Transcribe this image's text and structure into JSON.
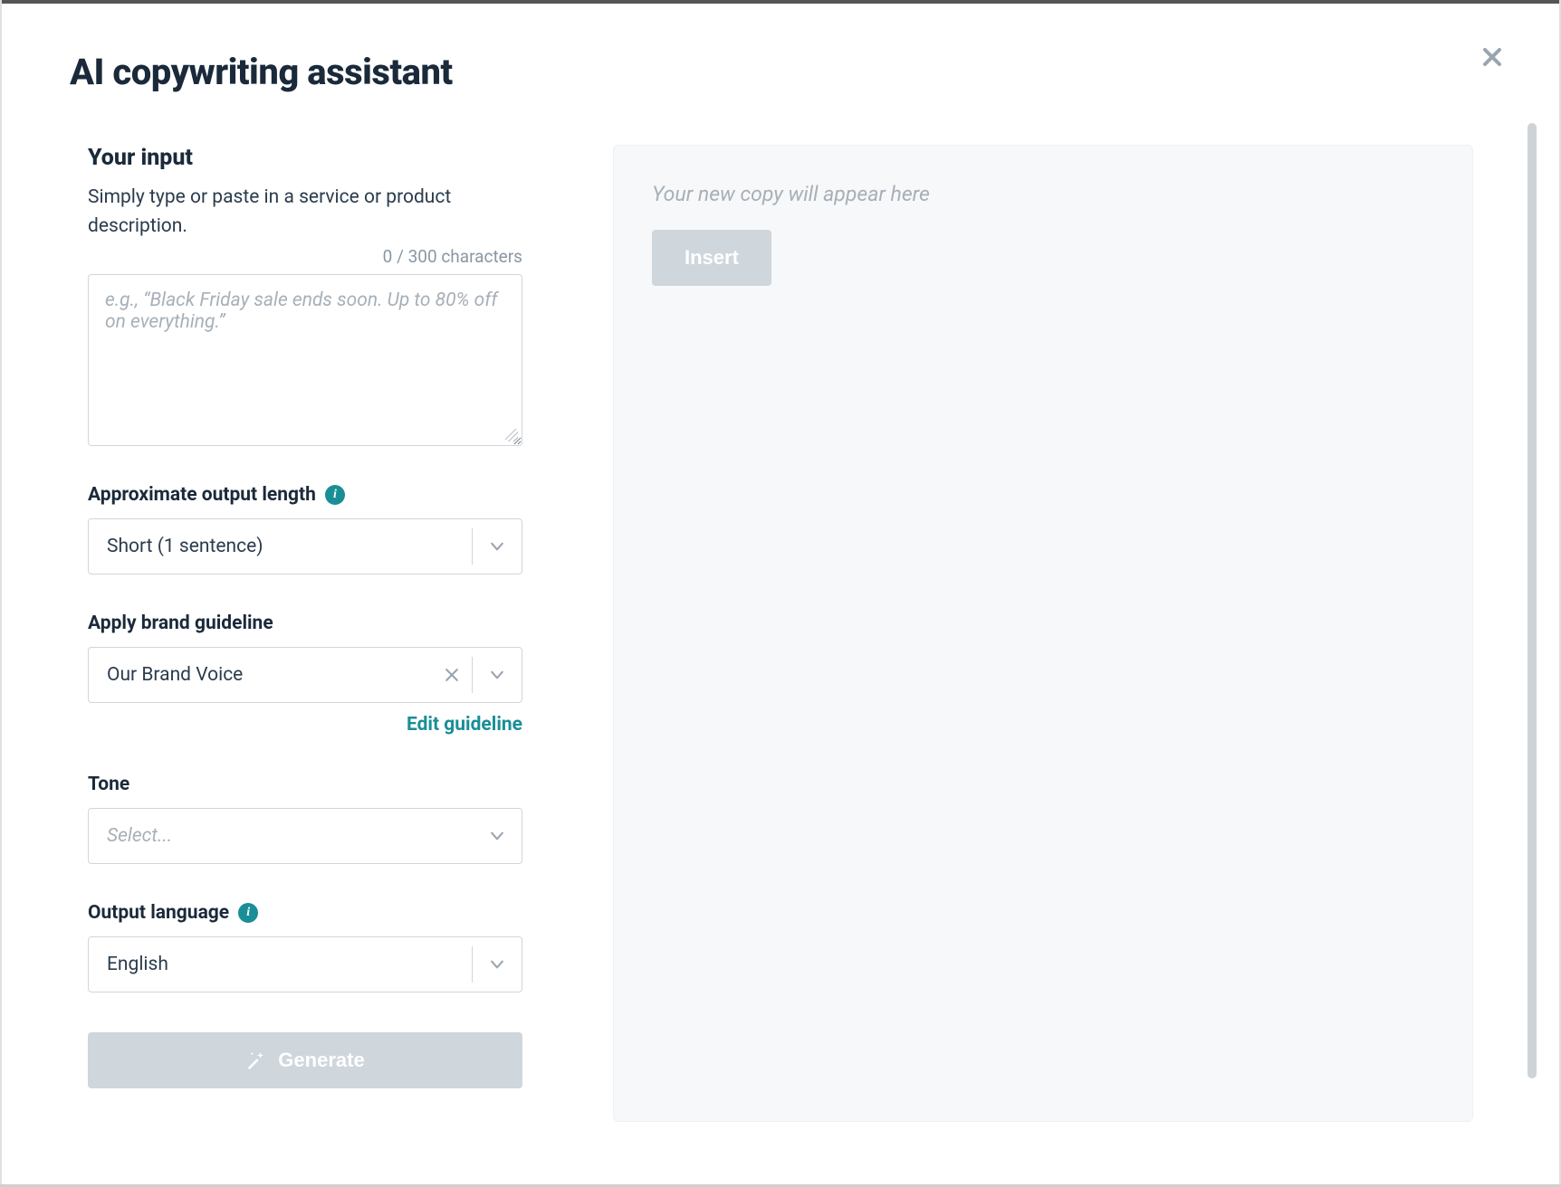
{
  "modal": {
    "title": "AI copywriting assistant"
  },
  "input_section": {
    "heading": "Your input",
    "description": "Simply type or paste in a service or product description.",
    "char_counter": "0 / 300 characters",
    "textarea_placeholder": "e.g., “Black Friday sale ends soon. Up to 80% off on everything.”"
  },
  "fields": {
    "output_length": {
      "label": "Approximate output length",
      "selected": "Short (1 sentence)"
    },
    "brand_guideline": {
      "label": "Apply brand guideline",
      "selected": "Our Brand Voice",
      "edit_link": "Edit guideline"
    },
    "tone": {
      "label": "Tone",
      "placeholder": "Select..."
    },
    "output_language": {
      "label": "Output language",
      "selected": "English"
    }
  },
  "buttons": {
    "generate": "Generate",
    "insert": "Insert"
  },
  "output_panel": {
    "placeholder": "Your new copy will appear here"
  },
  "info_icon_char": "i"
}
